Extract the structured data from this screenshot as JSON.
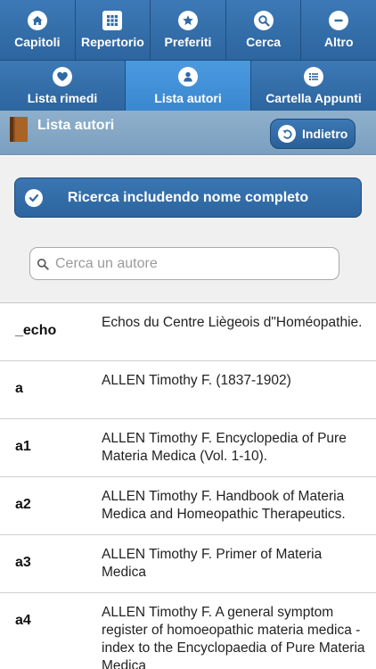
{
  "nav": {
    "row1": [
      {
        "label": "Capitoli",
        "icon": "home-icon"
      },
      {
        "label": "Repertorio",
        "icon": "grid-icon"
      },
      {
        "label": "Preferiti",
        "icon": "star-icon"
      },
      {
        "label": "Cerca",
        "icon": "search-icon"
      },
      {
        "label": "Altro",
        "icon": "minus-icon"
      }
    ],
    "row2": [
      {
        "label": "Lista rimedi",
        "icon": "heart-icon"
      },
      {
        "label": "Lista autori",
        "icon": "user-icon",
        "active": true
      },
      {
        "label": "Cartella Appunti",
        "icon": "list-icon"
      }
    ]
  },
  "header": {
    "title": "Lista autori",
    "back_label": "Indietro"
  },
  "filter": {
    "toggle_label": "Ricerca includendo nome completo",
    "search_placeholder": "Cerca un autore",
    "search_value": ""
  },
  "authors": [
    {
      "code": "_echo",
      "name": "Echos du Centre Liègeois d\"Homéopathie."
    },
    {
      "code": "a",
      "name": "ALLEN Timothy F. (1837-1902)"
    },
    {
      "code": "a1",
      "name": "ALLEN Timothy F. Encyclopedia of Pure Materia Medica (Vol. 1-10)."
    },
    {
      "code": "a2",
      "name": "ALLEN Timothy F. Handbook of Materia Medica and Homeopathic Therapeutics."
    },
    {
      "code": "a3",
      "name": "ALLEN Timothy F. Primer of Materia Medica"
    },
    {
      "code": "a4",
      "name": "ALLEN Timothy F. A general symptom register of homoeopathic materia medica - index to the Encyclopaedia of Pure Materia Medica"
    }
  ],
  "colors": {
    "nav_blue": "#2f6aa6",
    "nav_active": "#4191d8",
    "titlebar": "#87a9c7"
  }
}
